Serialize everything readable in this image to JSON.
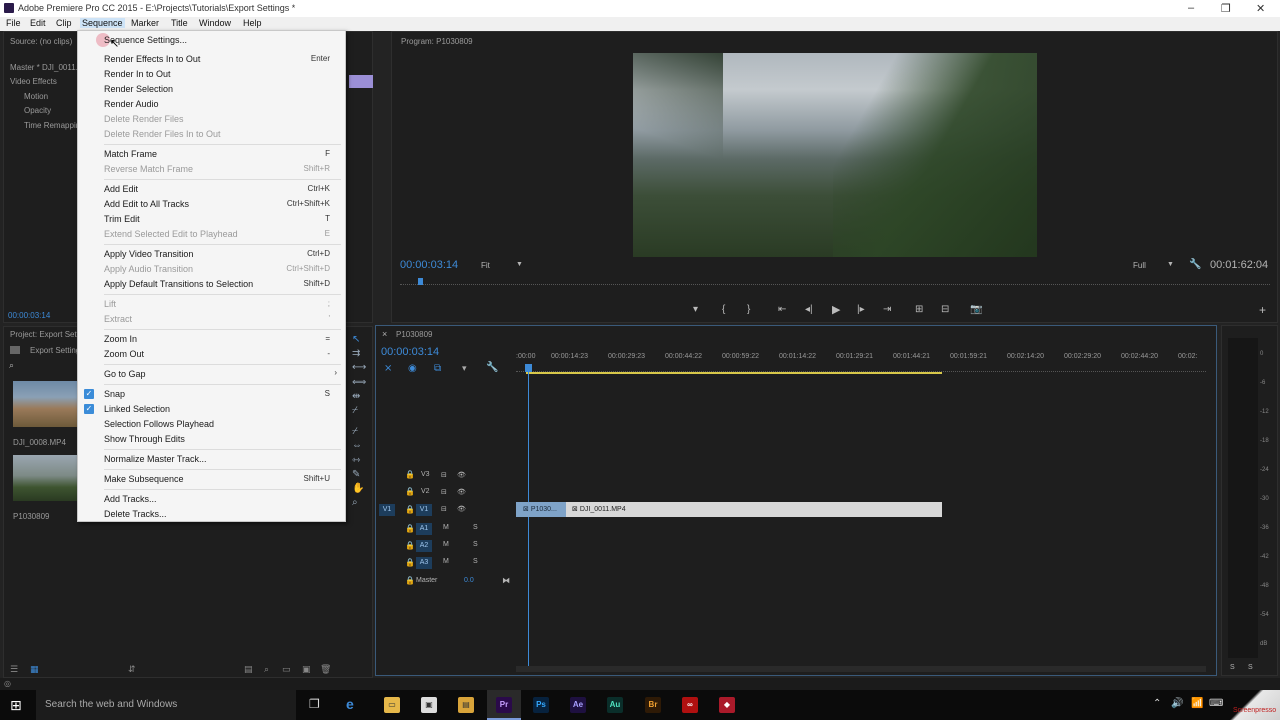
{
  "window": {
    "title": "Adobe Premiere Pro CC 2015 - E:\\Projects\\Tutorials\\Export Settings *"
  },
  "menubar": [
    "File",
    "Edit",
    "Clip",
    "Sequence",
    "Marker",
    "Title",
    "Window",
    "Help"
  ],
  "source_panel": {
    "label": "Source: (no clips)",
    "master": "Master * DJI_0011...",
    "video_effects": "Video Effects",
    "effects": [
      "Motion",
      "Opacity",
      "Time Remapping"
    ],
    "timecode": "00:00:03:14"
  },
  "project_panel": {
    "label": "Project: Export Settings",
    "bin": "Export Settings",
    "items": [
      "DJI_0008.MP4",
      "P1030809"
    ]
  },
  "sequence_menu": {
    "items": [
      {
        "label": "Sequence Settings...",
        "shortcut": "",
        "disabled": false
      },
      {
        "label": "Render Effects In to Out",
        "shortcut": "Enter",
        "disabled": false
      },
      {
        "label": "Render In to Out",
        "shortcut": "",
        "disabled": false
      },
      {
        "label": "Render Selection",
        "shortcut": "",
        "disabled": false
      },
      {
        "label": "Render Audio",
        "shortcut": "",
        "disabled": false
      },
      {
        "label": "Delete Render Files",
        "shortcut": "",
        "disabled": true
      },
      {
        "label": "Delete Render Files In to Out",
        "shortcut": "",
        "disabled": true
      },
      {
        "label": "Match Frame",
        "shortcut": "F",
        "disabled": false
      },
      {
        "label": "Reverse Match Frame",
        "shortcut": "Shift+R",
        "disabled": true
      },
      {
        "label": "Add Edit",
        "shortcut": "Ctrl+K",
        "disabled": false
      },
      {
        "label": "Add Edit to All Tracks",
        "shortcut": "Ctrl+Shift+K",
        "disabled": false
      },
      {
        "label": "Trim Edit",
        "shortcut": "T",
        "disabled": false
      },
      {
        "label": "Extend Selected Edit to Playhead",
        "shortcut": "E",
        "disabled": true
      },
      {
        "label": "Apply Video Transition",
        "shortcut": "Ctrl+D",
        "disabled": false
      },
      {
        "label": "Apply Audio Transition",
        "shortcut": "Ctrl+Shift+D",
        "disabled": true
      },
      {
        "label": "Apply Default Transitions to Selection",
        "shortcut": "Shift+D",
        "disabled": false
      },
      {
        "label": "Lift",
        "shortcut": ";",
        "disabled": true
      },
      {
        "label": "Extract",
        "shortcut": "'",
        "disabled": true
      },
      {
        "label": "Zoom In",
        "shortcut": "=",
        "disabled": false
      },
      {
        "label": "Zoom Out",
        "shortcut": "-",
        "disabled": false
      },
      {
        "label": "Go to Gap",
        "shortcut": "›",
        "disabled": false
      },
      {
        "label": "Snap",
        "shortcut": "S",
        "disabled": false
      },
      {
        "label": "Linked Selection",
        "shortcut": "",
        "disabled": false
      },
      {
        "label": "Selection Follows Playhead",
        "shortcut": "",
        "disabled": false
      },
      {
        "label": "Show Through Edits",
        "shortcut": "",
        "disabled": false
      },
      {
        "label": "Normalize Master Track...",
        "shortcut": "",
        "disabled": false
      },
      {
        "label": "Make Subsequence",
        "shortcut": "Shift+U",
        "disabled": false
      },
      {
        "label": "Add Tracks...",
        "shortcut": "",
        "disabled": false
      },
      {
        "label": "Delete Tracks...",
        "shortcut": "",
        "disabled": false
      }
    ]
  },
  "program_monitor": {
    "label": "Program: P1030809",
    "timecode": "00:00:03:14",
    "fit": "Fit",
    "quality": "Full",
    "duration": "00:01:62:04"
  },
  "timeline": {
    "sequence_name": "P1030809",
    "timecode": "00:00:03:14",
    "ruler": [
      ":00:00",
      "00:00:14:23",
      "00:00:29:23",
      "00:00:44:22",
      "00:00:59:22",
      "00:01:14:22",
      "00:01:29:21",
      "00:01:44:21",
      "00:01:59:21",
      "00:02:14:20",
      "00:02:29:20",
      "00:02:44:20",
      "00:02:"
    ],
    "video_tracks": [
      "V3",
      "V2",
      "V1"
    ],
    "audio_tracks": [
      "A1",
      "A2",
      "A3"
    ],
    "master_label": "Master",
    "master_value": "0.0",
    "clip_a": "P1030...",
    "clip_b": "DJI_0011.MP4"
  },
  "meter_labels": [
    "0",
    "-6",
    "-12",
    "-18",
    "-24",
    "-30",
    "-36",
    "-42",
    "-48",
    "-54",
    "dB"
  ],
  "taskbar": {
    "search": "Search the web and Windows",
    "apps": [
      "Pr",
      "Ps",
      "Ae",
      "Au",
      "Br"
    ]
  },
  "watermark": "Screenpresso"
}
